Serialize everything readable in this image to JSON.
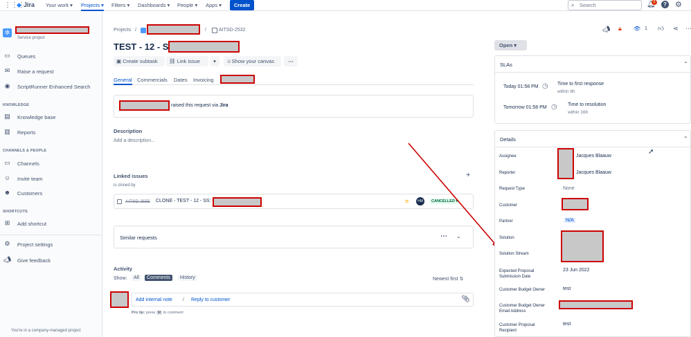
{
  "nav": {
    "logo": "Jira",
    "items": [
      "Your work",
      "Projects",
      "Filters",
      "Dashboards",
      "People",
      "Apps"
    ],
    "create": "Create",
    "search_placeholder": "Search",
    "notif_count": "2"
  },
  "sidebar": {
    "project_type": "Service project",
    "items": [
      "Queues",
      "Raise a request",
      "ScriptRunner Enhanced Search"
    ],
    "knowledge_head": "KNOWLEDGE",
    "knowledge_items": [
      "Knowledge base",
      "Reports"
    ],
    "channels_head": "CHANNELS & PEOPLE",
    "channels_items": [
      "Channels",
      "Invite team",
      "Customers"
    ],
    "shortcuts_head": "SHORTCUTS",
    "shortcuts_items": [
      "Add shortcut"
    ],
    "bottom_items": [
      "Project settings",
      "Give feedback"
    ],
    "footer": "You're in a company-managed project"
  },
  "breadcrumb": {
    "projects": "Projects",
    "issue_key": "AITSD-2532",
    "sep": "/"
  },
  "issue": {
    "title": "TEST - 12 - SS:",
    "actions": [
      "Create subtask",
      "Link issue",
      "Show your canvas"
    ],
    "watch_count": "1",
    "tabs": [
      "General",
      "Commercials",
      "Dates",
      "Invoicing"
    ],
    "raised_text": "raised this request via",
    "raised_via": "Jira",
    "description_head": "Description",
    "description_placeholder": "Add a description...",
    "linked_head": "Linked issues",
    "linked_rel": "is cloned by",
    "linked_key": "AITSD-2555",
    "linked_summary": "CLONE - TEST - 12 - SS:",
    "linked_assignee": "HM",
    "linked_status": "CANCELLED",
    "similar": "Similar requests",
    "activity_head": "Activity",
    "show": "Show:",
    "filters": [
      "All",
      "Comments",
      "History"
    ],
    "sort": "Newest first",
    "add_note": "Add internal note",
    "slash": "/",
    "reply": "Reply to customer",
    "pro_tip_prefix": "Pro tip:",
    "pro_tip_press": "press",
    "pro_tip_key": "M",
    "pro_tip_suffix": "to comment"
  },
  "right": {
    "status": "Open",
    "slas_head": "SLAs",
    "slas": [
      {
        "when": "Today 01:58 PM",
        "name": "Time to first response",
        "within": "within 8h"
      },
      {
        "when": "Tomorrow 01:58 PM",
        "name": "Time to resolution",
        "within": "within 16h"
      }
    ],
    "details_head": "Details",
    "fields": {
      "assignee": "Assignee",
      "assignee_val": "Jacques Blaauw",
      "reporter": "Reporter",
      "reporter_val": "Jacques Blaauw",
      "request_type": "Request Type",
      "request_type_val": "None",
      "customer": "Customer",
      "partner": "Partner",
      "partner_val": "N/A",
      "solution": "Solution",
      "solution_stream": "Solution Stream",
      "expected": "Expected Proposal Submission Date",
      "expected_val": "23 Jun 2022",
      "budget_owner": "Customer Budget Owner",
      "budget_owner_val": "test",
      "budget_email": "Customer Budget Owner Email Address",
      "proposal_recipient": "Customer Proposal Recipient",
      "proposal_recipient_val": "test"
    }
  }
}
